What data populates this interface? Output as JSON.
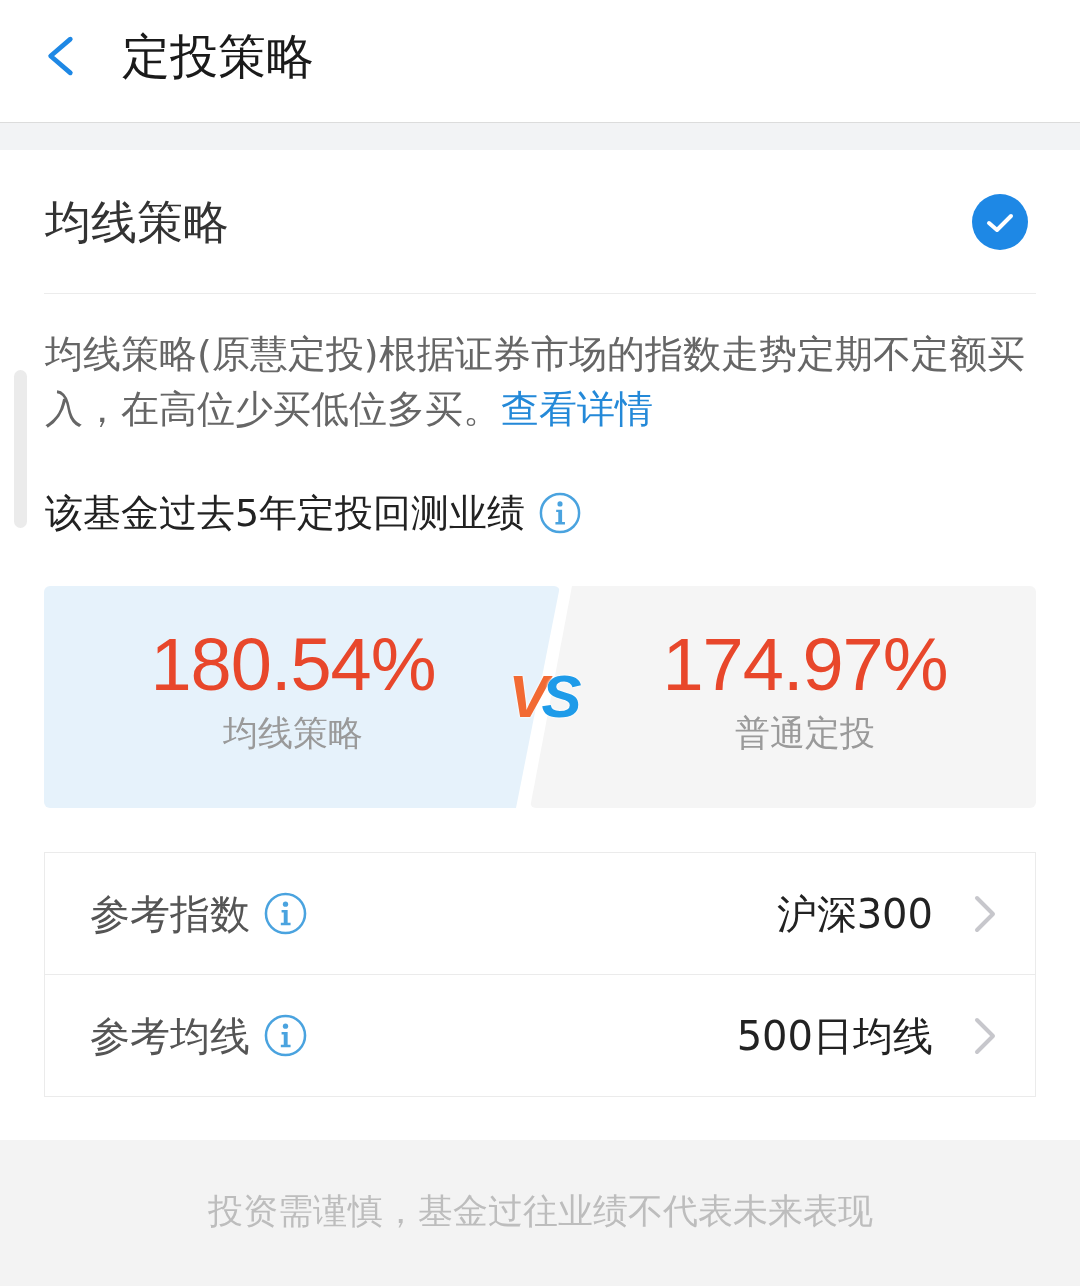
{
  "header": {
    "title": "定投策略"
  },
  "strategy": {
    "name": "均线策略",
    "selected": true,
    "description": "均线策略(原慧定投)根据证券市场的指数走势定期不定额买入，在高位少买低位多买。",
    "link": "查看详情"
  },
  "backtest": {
    "title": "该基金过去5年定投回测业绩",
    "comparison": {
      "left": {
        "value": "180.54%",
        "label": "均线策略"
      },
      "vs": "VS",
      "right": {
        "value": "174.97%",
        "label": "普通定投"
      }
    }
  },
  "settings": [
    {
      "label": "参考指数",
      "value": "沪深300"
    },
    {
      "label": "参考均线",
      "value": "500日均线"
    }
  ],
  "footer": {
    "disclaimer": "投资需谨慎，基金过往业绩不代表未来表现"
  }
}
